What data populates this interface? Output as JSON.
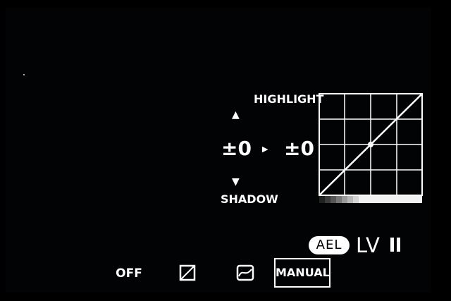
{
  "tone_curve": {
    "highlight_label": "HIGHLIGHT",
    "shadow_label": "SHADOW",
    "shadow_value": "±0",
    "highlight_value": "±0"
  },
  "status": {
    "ael_label": "AEL",
    "lv_label": "LV"
  },
  "modes": {
    "off_label": "OFF",
    "manual_label": "MANUAL",
    "selected": "MANUAL"
  },
  "watermark": "",
  "icons": {
    "arrow_up": "triangle-up-icon",
    "arrow_down": "triangle-down-icon",
    "arrow_right": "triangle-right-icon",
    "pause": "pause-icon",
    "mode_1": "contrast-square-icon",
    "mode_2": "tone-curve-icon"
  },
  "colors": {
    "background": "#000000",
    "foreground": "#ffffff"
  }
}
